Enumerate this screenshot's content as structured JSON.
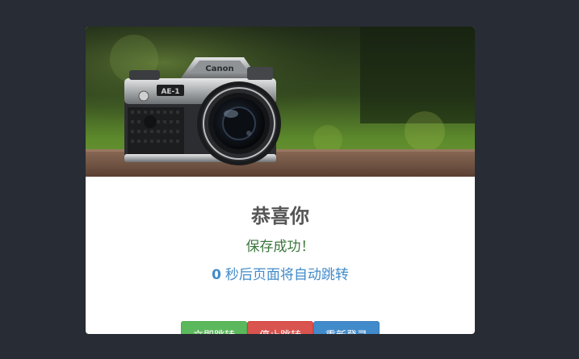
{
  "card": {
    "title": "恭喜你",
    "subtitle": "保存成功！",
    "countdown_number": "0",
    "countdown_text": "秒后页面将自动跳转"
  },
  "hero": {
    "camera_brand": "Canon",
    "camera_model": "AE-1"
  },
  "buttons": {
    "jump_now": "立即跳转",
    "stop_jump": "停止跳转",
    "relogin": "重新登录"
  },
  "colors": {
    "background": "#282c34",
    "success_text": "#3c763d",
    "primary_text": "#428bca",
    "green": "#5cb85c",
    "red": "#d9534f",
    "blue": "#428bca"
  }
}
